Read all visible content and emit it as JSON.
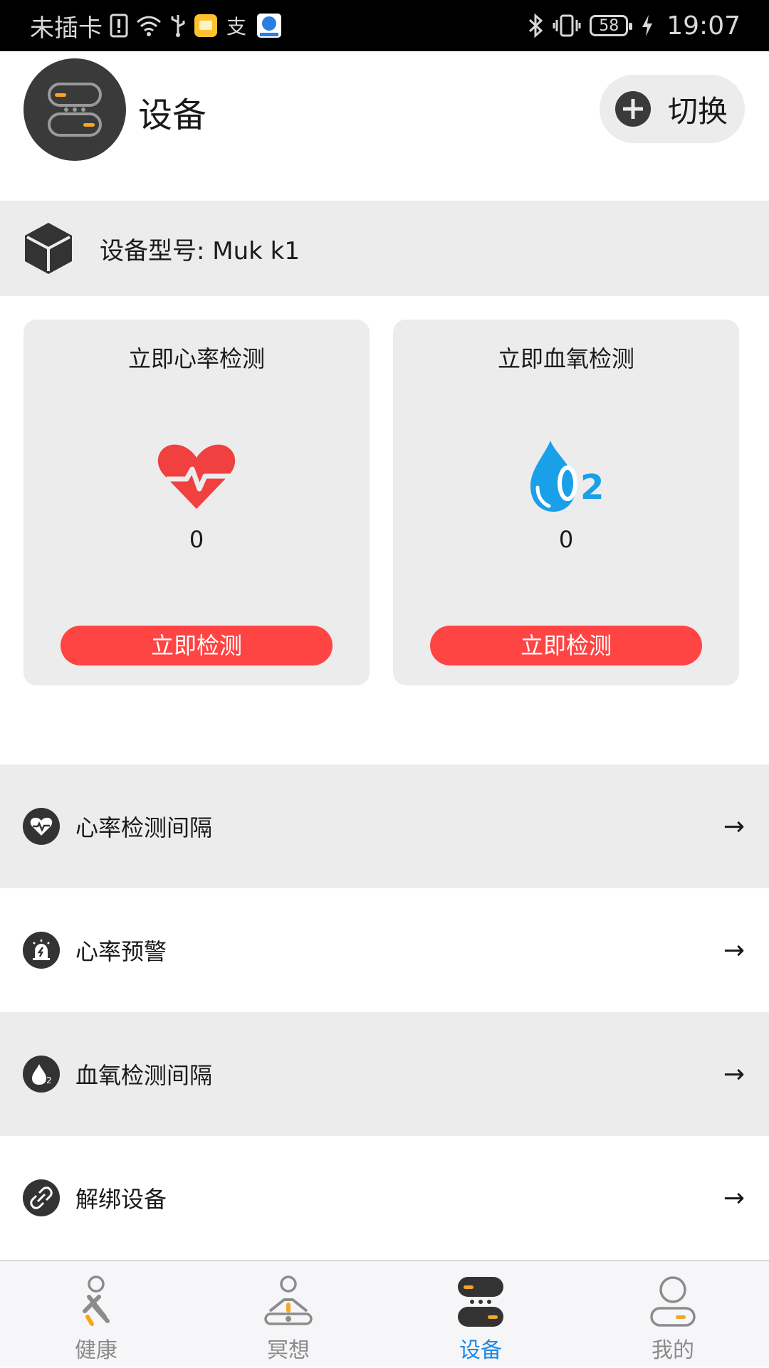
{
  "status_bar": {
    "carrier": "未插卡",
    "battery": "58",
    "time": "19:07"
  },
  "header": {
    "title": "设备",
    "switch_label": "切换"
  },
  "device": {
    "model_label": "设备型号: Muk k1"
  },
  "cards": [
    {
      "title": "立即心率检测",
      "value": "0",
      "button": "立即检测",
      "icon": "heart-rate-icon",
      "color": "#f04040"
    },
    {
      "title": "立即血氧检测",
      "value": "0",
      "button": "立即检测",
      "icon": "blood-oxygen-icon",
      "color": "#1aa0e8"
    }
  ],
  "settings": [
    {
      "label": "心率检测间隔",
      "icon": "heart-interval-icon",
      "arrow": "→"
    },
    {
      "label": "心率预警",
      "icon": "alarm-icon",
      "arrow": "→"
    },
    {
      "label": "血氧检测间隔",
      "icon": "oxygen-interval-icon",
      "arrow": "→"
    },
    {
      "label": "解绑设备",
      "icon": "unlink-icon",
      "arrow": "→"
    }
  ],
  "nav": {
    "items": [
      {
        "label": "健康",
        "icon": "health-icon"
      },
      {
        "label": "冥想",
        "icon": "meditation-icon"
      },
      {
        "label": "设备",
        "icon": "device-icon",
        "active": true
      },
      {
        "label": "我的",
        "icon": "profile-icon"
      }
    ]
  },
  "colors": {
    "accent_red": "#ff4444",
    "accent_blue": "#1e88e5",
    "accent_orange": "#f5a623",
    "panel_gray": "#ececec"
  }
}
